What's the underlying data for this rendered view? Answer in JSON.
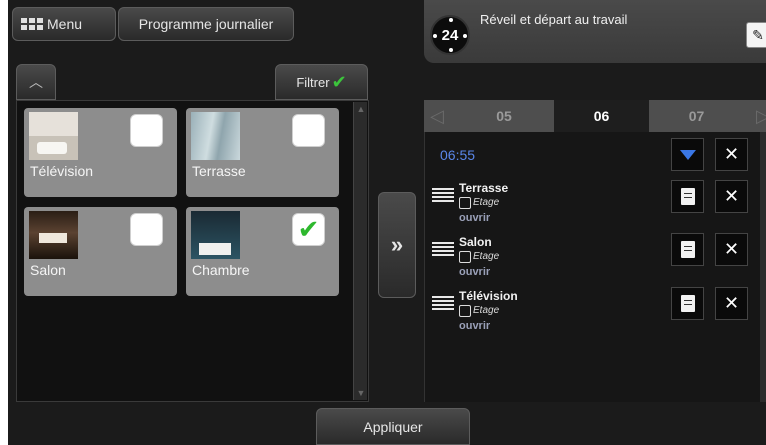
{
  "header": {
    "menu_label": "Menu",
    "program_label": "Programme journalier"
  },
  "schedule": {
    "clock_value": "24",
    "title": "Réveil et départ au travail"
  },
  "filter": {
    "label": "Filtrer"
  },
  "devices": [
    {
      "label": "Télévision",
      "checked": false
    },
    {
      "label": "Terrasse",
      "checked": false
    },
    {
      "label": "Salon",
      "checked": false
    },
    {
      "label": "Chambre",
      "checked": true
    }
  ],
  "day_tabs": [
    {
      "label": "05",
      "active": false
    },
    {
      "label": "06",
      "active": true
    },
    {
      "label": "07",
      "active": false
    }
  ],
  "time_entry": "06:55",
  "actions": [
    {
      "name": "Terrasse",
      "floor": "Etage",
      "action": "ouvrir"
    },
    {
      "name": "Salon",
      "floor": "Etage",
      "action": "ouvrir"
    },
    {
      "name": "Télévision",
      "floor": "Etage",
      "action": "ouvrir"
    }
  ],
  "footer": {
    "apply_label": "Appliquer"
  },
  "colors": {
    "accent_blue": "#3a77e6",
    "time_blue": "#5a86e8",
    "check_green": "#2eb82e"
  }
}
